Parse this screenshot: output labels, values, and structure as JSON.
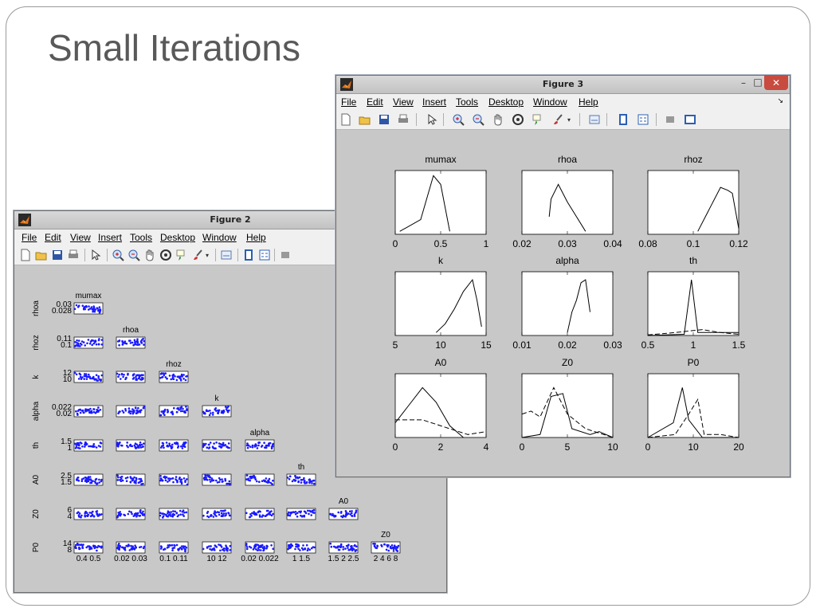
{
  "slide": {
    "title": "Small Iterations"
  },
  "figure2": {
    "title": "Figure 2",
    "menu": [
      "File",
      "Edit",
      "View",
      "Insert",
      "Tools",
      "Desktop",
      "Window",
      "Help"
    ],
    "row_labels": [
      "rhoa",
      "rhoz",
      "k",
      "alpha",
      "th",
      "A0",
      "Z0",
      "P0"
    ],
    "col_labels": [
      "mumax",
      "rhoa",
      "rhoz",
      "k",
      "alpha",
      "th",
      "A0",
      "Z0"
    ],
    "row_ticks": [
      "0.03\n0.028",
      "0.11\n0.1",
      "12\n10",
      "0.022\n0.02",
      "1.5\n1",
      "2.5\n1.5",
      "6\n4",
      "14\n8"
    ],
    "bottom_ticks": [
      "0.4 0.5",
      "0.02 0.03",
      "0.1 0.11",
      "10 12",
      "0.02 0.022",
      "1 1.5",
      "1.5 2 2.5",
      "2 4 6 8"
    ]
  },
  "figure3": {
    "title": "Figure 3",
    "menu": [
      "File",
      "Edit",
      "View",
      "Insert",
      "Tools",
      "Desktop",
      "Window",
      "Help"
    ],
    "panels": [
      {
        "title": "mumax",
        "ticks": [
          "0",
          "0.5",
          "1"
        ]
      },
      {
        "title": "rhoa",
        "ticks": [
          "0.02",
          "0.03",
          "0.04"
        ]
      },
      {
        "title": "rhoz",
        "ticks": [
          "0.08",
          "0.1",
          "0.12"
        ]
      },
      {
        "title": "k",
        "ticks": [
          "5",
          "10",
          "15"
        ]
      },
      {
        "title": "alpha",
        "ticks": [
          "0.01",
          "0.02",
          "0.03"
        ]
      },
      {
        "title": "th",
        "ticks": [
          "0.5",
          "1",
          "1.5"
        ]
      },
      {
        "title": "A0",
        "ticks": [
          "0",
          "2",
          "4"
        ]
      },
      {
        "title": "Z0",
        "ticks": [
          "0",
          "5",
          "10"
        ]
      },
      {
        "title": "P0",
        "ticks": [
          "0",
          "10",
          "20"
        ]
      }
    ]
  },
  "colors": {
    "scatter": "#1a1aff",
    "figure_bg": "#c8c8c8",
    "title": "#595959"
  }
}
